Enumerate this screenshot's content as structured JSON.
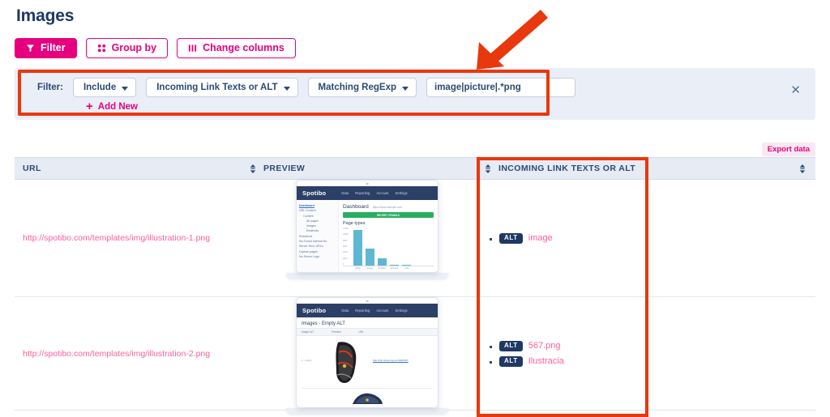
{
  "page": {
    "title": "Images"
  },
  "toolbar": {
    "filter_label": "Filter",
    "group_by_label": "Group by",
    "change_columns_label": "Change columns"
  },
  "filter_panel": {
    "label": "Filter:",
    "mode": "Include",
    "field": "Incoming Link Texts or ALT",
    "operator": "Matching RegExp",
    "value": "image|picture|.*png",
    "value_placeholder": "",
    "add_new_label": "Add New",
    "close_label": "✕"
  },
  "export": {
    "label": "Export data"
  },
  "table": {
    "columns": [
      {
        "label": "URL"
      },
      {
        "label": "PREVIEW"
      },
      {
        "label": "INCOMING LINK TEXTS OR ALT"
      }
    ],
    "rows": [
      {
        "url": "http://spotibo.com/templates/img/illustration-1.png",
        "alts": [
          {
            "badge": "ALT",
            "text": "image"
          }
        ]
      },
      {
        "url": "http://spotibo.com/templates/img/illustration-2.png",
        "alts": [
          {
            "badge": "ALT",
            "text": "567.png"
          },
          {
            "badge": "ALT",
            "text": "Ilustracia"
          }
        ]
      }
    ]
  },
  "preview1": {
    "brand": "Spotibo",
    "nav": [
      "Data",
      "Reporting",
      "Account",
      "Settings"
    ],
    "sidebar": [
      "Dashboard",
      "URL Content",
      "Content",
      "All pages",
      "Images",
      "Redirects",
      "Robots.txt",
      "No Found Internal No",
      "Server Error URLs",
      "Orphan pages",
      "No Server Logs"
    ],
    "heading": "Dashboard",
    "heading_url": "https://www.example.com",
    "green_bar_text": "RECENT CRAWLS",
    "chart_title": "Page types",
    "y_ticks": [
      "12000",
      "10000",
      "8000",
      "6000",
      "4000",
      "2000",
      "0"
    ],
    "x_labels": [
      "HTML",
      "Image",
      "Redirect",
      "External",
      "CSS"
    ],
    "values": [
      11500,
      5600,
      2400,
      150,
      90
    ]
  },
  "preview2": {
    "brand": "Spotibo",
    "nav": [
      "Data",
      "Reporting",
      "Account",
      "Settings"
    ],
    "heading": "Images  -  Empty ALT",
    "columns": [
      "Image ALT",
      "Preview",
      "URL"
    ],
    "row_label": "1 - empty",
    "row_url": "http://cdn.shop.img.com/908-567"
  },
  "colors": {
    "brand_pink": "#e6007e",
    "annotation_red": "#e8380d",
    "navy": "#1f3864",
    "link_pink": "#f9619c",
    "panel_bg": "#eaeef7",
    "table_head": "#e6ebf4"
  }
}
